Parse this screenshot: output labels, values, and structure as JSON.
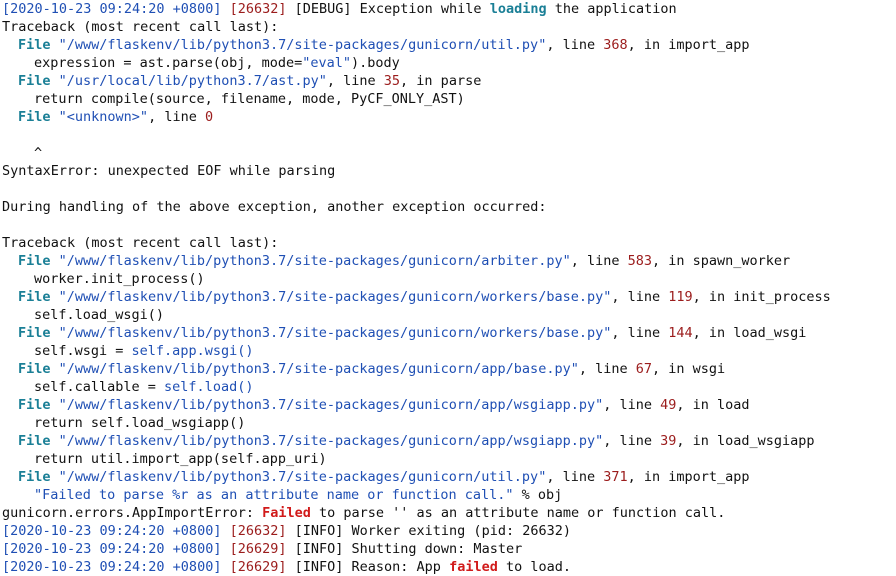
{
  "log_lines": [
    {
      "indent": 0,
      "segs": [
        [
          "ts",
          "[2020-10-23 09:24:20 +0800]"
        ],
        [
          "t",
          " "
        ],
        [
          "num",
          "[26632]"
        ],
        [
          "t",
          " [DEBUG] Exception while "
        ],
        [
          "kw",
          "loading"
        ],
        [
          "t",
          " the application"
        ]
      ]
    },
    {
      "indent": 0,
      "segs": [
        [
          "t",
          "Traceback (most recent call last):"
        ]
      ]
    },
    {
      "indent": 1,
      "segs": [
        [
          "kw",
          "File"
        ],
        [
          "t",
          " "
        ],
        [
          "path",
          "\"/www/flaskenv/lib/python3.7/site-packages/gunicorn/util.py\""
        ],
        [
          "t",
          ", line "
        ],
        [
          "num",
          "368"
        ],
        [
          "t",
          ", in import_app"
        ]
      ]
    },
    {
      "indent": 2,
      "segs": [
        [
          "t",
          "expression = ast.parse(obj, mode="
        ],
        [
          "str",
          "\"eval\""
        ],
        [
          "t",
          ").body"
        ]
      ]
    },
    {
      "indent": 1,
      "segs": [
        [
          "kw",
          "File"
        ],
        [
          "t",
          " "
        ],
        [
          "path",
          "\"/usr/local/lib/python3.7/ast.py\""
        ],
        [
          "t",
          ", line "
        ],
        [
          "num",
          "35"
        ],
        [
          "t",
          ", in parse"
        ]
      ]
    },
    {
      "indent": 2,
      "segs": [
        [
          "t",
          "return compile(source, filename, mode, PyCF_ONLY_AST)"
        ]
      ]
    },
    {
      "indent": 1,
      "segs": [
        [
          "kw",
          "File"
        ],
        [
          "t",
          " "
        ],
        [
          "path",
          "\"<unknown>\""
        ],
        [
          "t",
          ", line "
        ],
        [
          "num",
          "0"
        ]
      ]
    },
    {
      "indent": 0,
      "segs": []
    },
    {
      "indent": 2,
      "segs": [
        [
          "t",
          "^"
        ]
      ]
    },
    {
      "indent": 0,
      "segs": [
        [
          "t",
          "SyntaxError: unexpected EOF while parsing"
        ]
      ]
    },
    {
      "indent": 0,
      "segs": []
    },
    {
      "indent": 0,
      "segs": [
        [
          "t",
          "During handling of the above exception, another exception occurred:"
        ]
      ]
    },
    {
      "indent": 0,
      "segs": []
    },
    {
      "indent": 0,
      "segs": [
        [
          "t",
          "Traceback (most recent call last):"
        ]
      ]
    },
    {
      "indent": 1,
      "segs": [
        [
          "kw",
          "File"
        ],
        [
          "t",
          " "
        ],
        [
          "path",
          "\"/www/flaskenv/lib/python3.7/site-packages/gunicorn/arbiter.py\""
        ],
        [
          "t",
          ", line "
        ],
        [
          "num",
          "583"
        ],
        [
          "t",
          ", in spawn_worker"
        ]
      ]
    },
    {
      "indent": 2,
      "segs": [
        [
          "t",
          "worker.init_process()"
        ]
      ]
    },
    {
      "indent": 1,
      "segs": [
        [
          "kw",
          "File"
        ],
        [
          "t",
          " "
        ],
        [
          "path",
          "\"/www/flaskenv/lib/python3.7/site-packages/gunicorn/workers/base.py\""
        ],
        [
          "t",
          ", line "
        ],
        [
          "num",
          "119"
        ],
        [
          "t",
          ", in init_process"
        ]
      ]
    },
    {
      "indent": 2,
      "segs": [
        [
          "t",
          "self.load_wsgi()"
        ]
      ]
    },
    {
      "indent": 1,
      "segs": [
        [
          "kw",
          "File"
        ],
        [
          "t",
          " "
        ],
        [
          "path",
          "\"/www/flaskenv/lib/python3.7/site-packages/gunicorn/workers/base.py\""
        ],
        [
          "t",
          ", line "
        ],
        [
          "num",
          "144"
        ],
        [
          "t",
          ", in load_wsgi"
        ]
      ]
    },
    {
      "indent": 2,
      "segs": [
        [
          "t",
          "self.wsgi = "
        ],
        [
          "blue",
          "self.app.wsgi()"
        ]
      ]
    },
    {
      "indent": 1,
      "segs": [
        [
          "kw",
          "File"
        ],
        [
          "t",
          " "
        ],
        [
          "path",
          "\"/www/flaskenv/lib/python3.7/site-packages/gunicorn/app/base.py\""
        ],
        [
          "t",
          ", line "
        ],
        [
          "num",
          "67"
        ],
        [
          "t",
          ", in wsgi"
        ]
      ]
    },
    {
      "indent": 2,
      "segs": [
        [
          "t",
          "self.callable = "
        ],
        [
          "blue",
          "self.load()"
        ]
      ]
    },
    {
      "indent": 1,
      "segs": [
        [
          "kw",
          "File"
        ],
        [
          "t",
          " "
        ],
        [
          "path",
          "\"/www/flaskenv/lib/python3.7/site-packages/gunicorn/app/wsgiapp.py\""
        ],
        [
          "t",
          ", line "
        ],
        [
          "num",
          "49"
        ],
        [
          "t",
          ", in load"
        ]
      ]
    },
    {
      "indent": 2,
      "segs": [
        [
          "t",
          "return self.load_wsgiapp()"
        ]
      ]
    },
    {
      "indent": 1,
      "segs": [
        [
          "kw",
          "File"
        ],
        [
          "t",
          " "
        ],
        [
          "path",
          "\"/www/flaskenv/lib/python3.7/site-packages/gunicorn/app/wsgiapp.py\""
        ],
        [
          "t",
          ", line "
        ],
        [
          "num",
          "39"
        ],
        [
          "t",
          ", in load_wsgiapp"
        ]
      ]
    },
    {
      "indent": 2,
      "segs": [
        [
          "t",
          "return util.import_app(self.app_uri)"
        ]
      ]
    },
    {
      "indent": 1,
      "segs": [
        [
          "kw",
          "File"
        ],
        [
          "t",
          " "
        ],
        [
          "path",
          "\"/www/flaskenv/lib/python3.7/site-packages/gunicorn/util.py\""
        ],
        [
          "t",
          ", line "
        ],
        [
          "num",
          "371"
        ],
        [
          "t",
          ", in import_app"
        ]
      ]
    },
    {
      "indent": 2,
      "segs": [
        [
          "str",
          "\"Failed to parse %r as an attribute name or function call.\""
        ],
        [
          "t",
          " % obj"
        ]
      ]
    },
    {
      "indent": 0,
      "segs": [
        [
          "t",
          "gunicorn.errors.AppImportError: "
        ],
        [
          "err",
          "Failed"
        ],
        [
          "t",
          " to parse '' as an attribute name or function call."
        ]
      ]
    },
    {
      "indent": 0,
      "segs": [
        [
          "ts",
          "[2020-10-23 09:24:20 +0800]"
        ],
        [
          "t",
          " "
        ],
        [
          "num",
          "[26632]"
        ],
        [
          "t",
          " [INFO] Worker exiting (pid: 26632)"
        ]
      ]
    },
    {
      "indent": 0,
      "segs": [
        [
          "ts",
          "[2020-10-23 09:24:20 +0800]"
        ],
        [
          "t",
          " "
        ],
        [
          "num",
          "[26629]"
        ],
        [
          "t",
          " [INFO] Shutting down: Master"
        ]
      ]
    },
    {
      "indent": 0,
      "segs": [
        [
          "ts",
          "[2020-10-23 09:24:20 +0800]"
        ],
        [
          "t",
          " "
        ],
        [
          "num",
          "[26629]"
        ],
        [
          "t",
          " [INFO] Reason: App "
        ],
        [
          "err",
          "failed"
        ],
        [
          "t",
          " to load."
        ]
      ]
    }
  ]
}
